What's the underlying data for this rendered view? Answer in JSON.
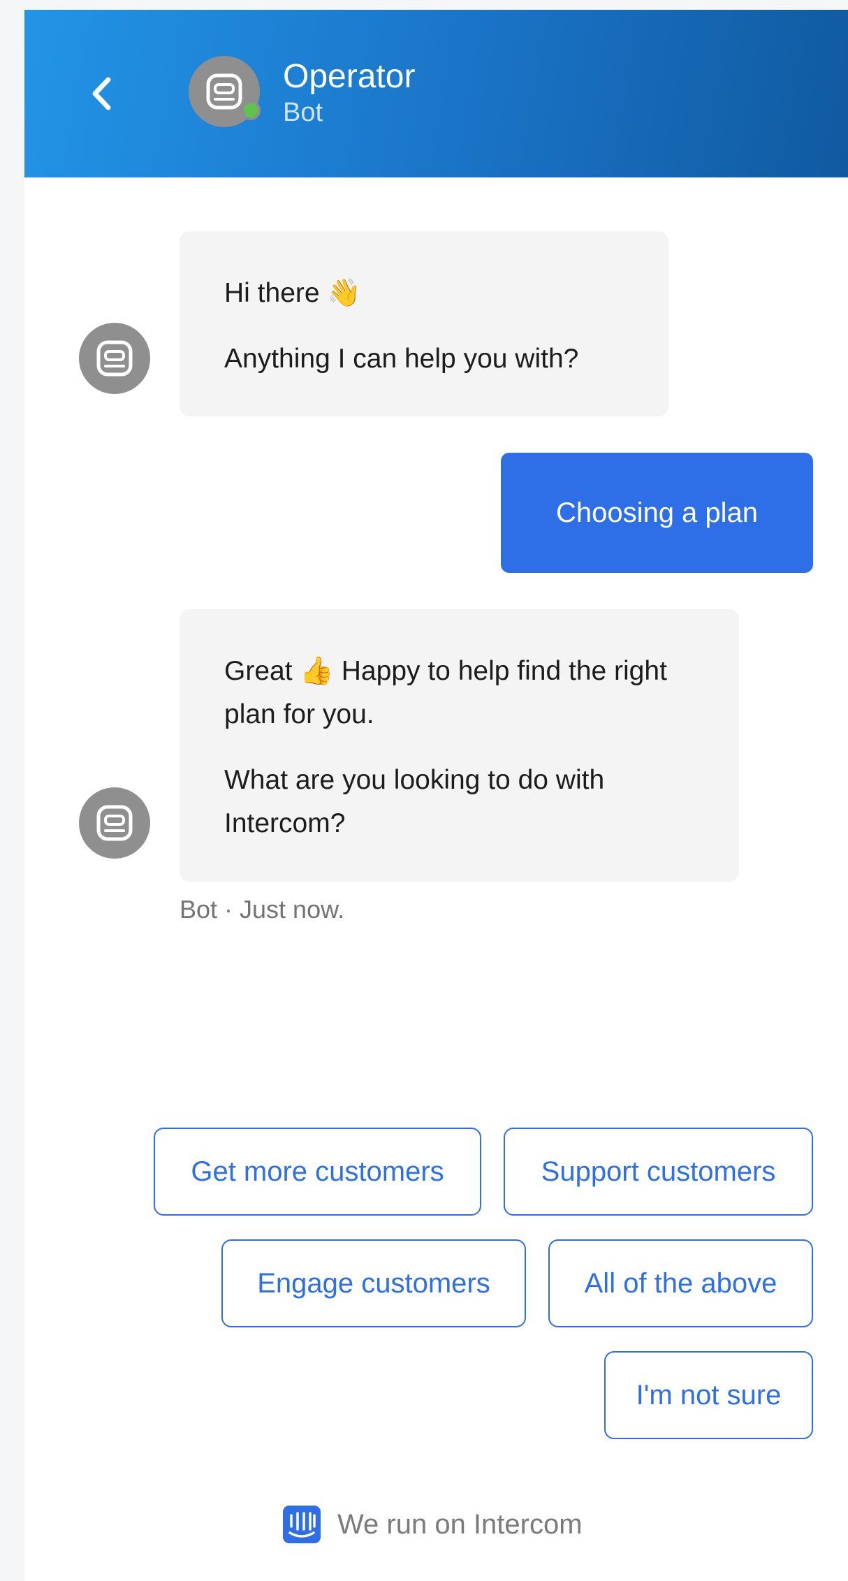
{
  "header": {
    "name": "Operator",
    "subtitle": "Bot",
    "status": "online",
    "accent_color": "#1a73c6"
  },
  "messages": [
    {
      "from": "bot",
      "lines": [
        "Hi there 👋",
        "Anything I can help you with?"
      ]
    },
    {
      "from": "user",
      "text": "Choosing a plan"
    },
    {
      "from": "bot",
      "lines": [
        "Great 👍 Happy to help find the right plan for you.",
        "What are you looking to do with Intercom?"
      ]
    }
  ],
  "meta": {
    "text": "Bot · Just now."
  },
  "quick_replies": [
    "Get more customers",
    "Support customers",
    "Engage customers",
    "All of the above",
    "I'm not sure"
  ],
  "footer": {
    "text": "We run on Intercom",
    "icon": "intercom-logo-icon"
  },
  "colors": {
    "user_bubble": "#2e6fe8",
    "bot_bubble": "#f4f4f4",
    "online": "#5ec54a"
  }
}
